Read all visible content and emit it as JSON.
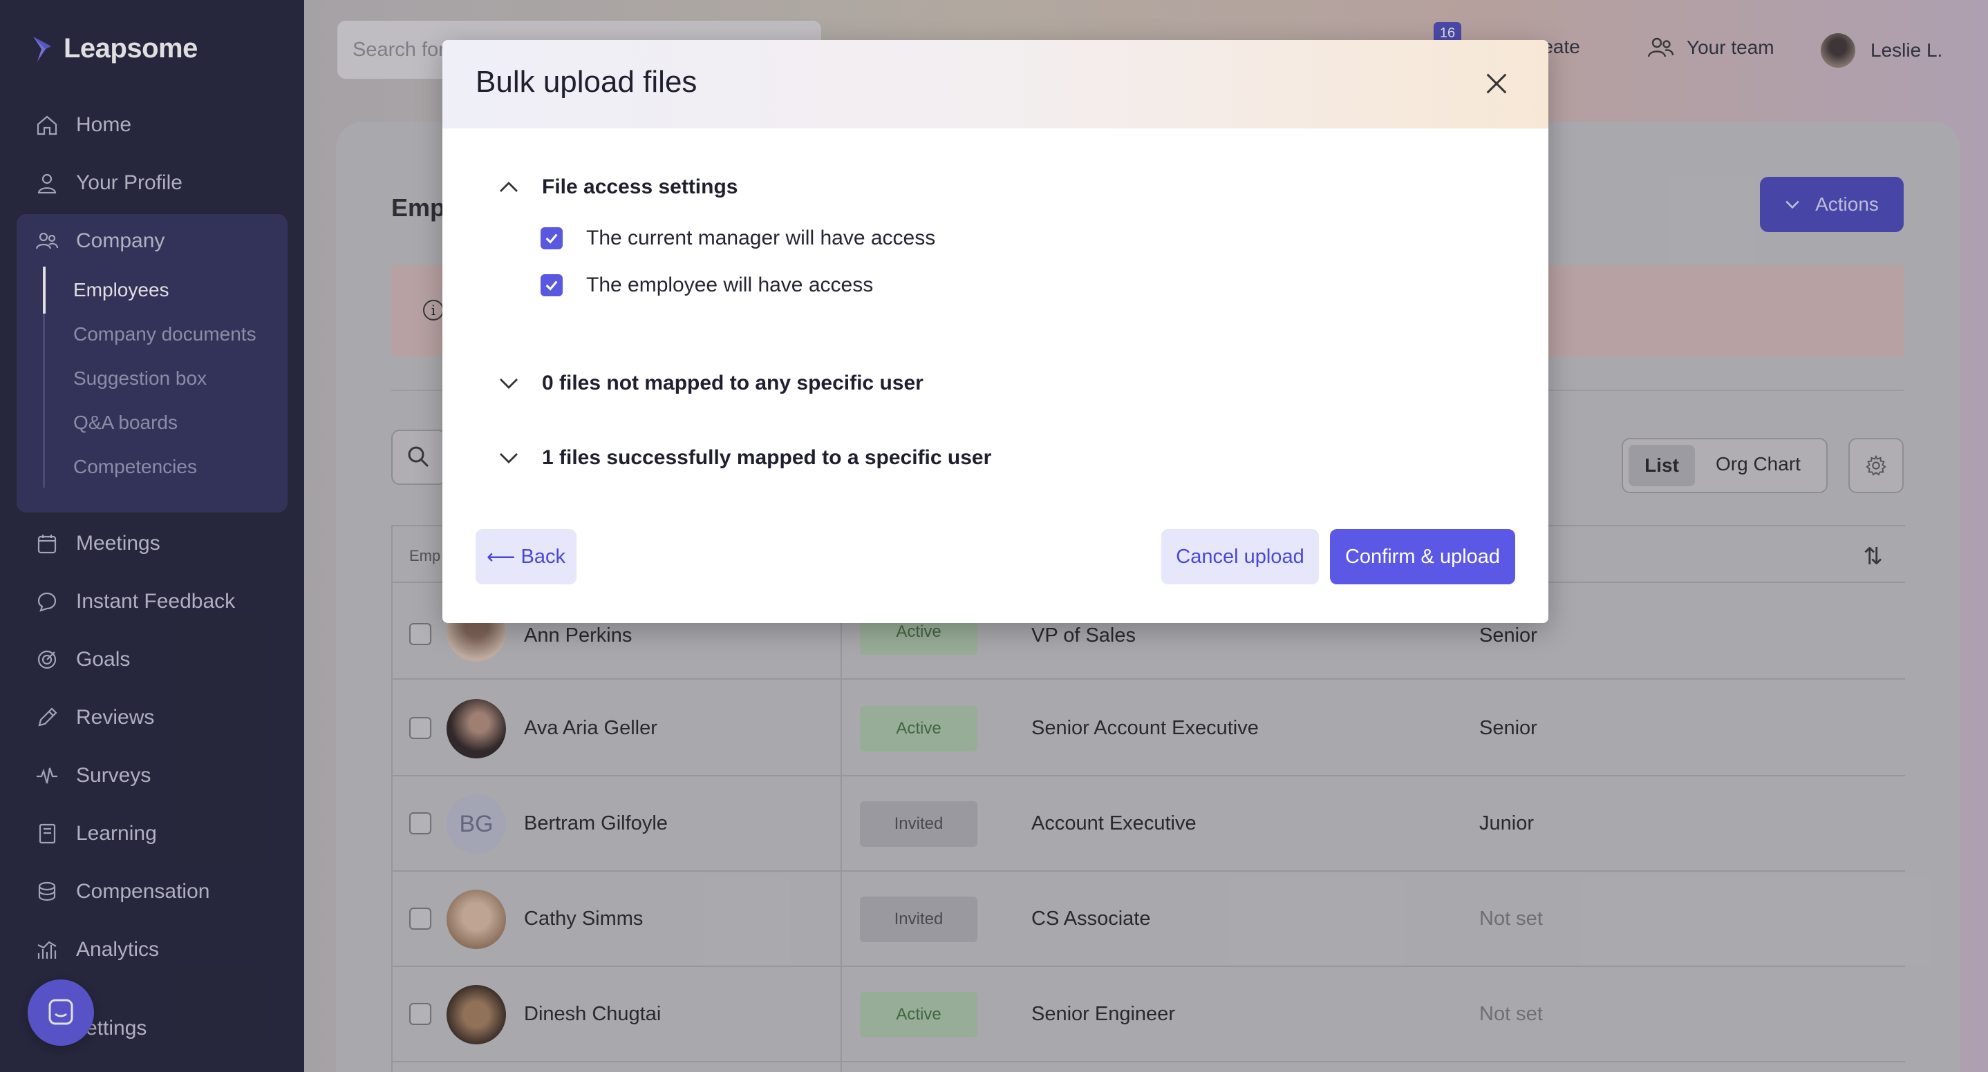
{
  "brand": {
    "name": "Leapsome"
  },
  "sidebar": {
    "items": [
      {
        "label": "Home",
        "icon": "home-icon"
      },
      {
        "label": "Your Profile",
        "icon": "user-icon"
      },
      {
        "label": "Company",
        "icon": "people-icon"
      },
      {
        "label": "Meetings",
        "icon": "calendar-icon"
      },
      {
        "label": "Instant Feedback",
        "icon": "chat-icon"
      },
      {
        "label": "Goals",
        "icon": "target-icon"
      },
      {
        "label": "Reviews",
        "icon": "pencil-icon"
      },
      {
        "label": "Surveys",
        "icon": "pulse-icon"
      },
      {
        "label": "Learning",
        "icon": "book-icon"
      },
      {
        "label": "Compensation",
        "icon": "coins-icon"
      },
      {
        "label": "Analytics",
        "icon": "chart-icon"
      },
      {
        "label": "ettings",
        "icon": "settings-icon"
      }
    ],
    "company_sub": [
      "Employees",
      "Company documents",
      "Suggestion box",
      "Q&A boards",
      "Competencies"
    ]
  },
  "topbar": {
    "search_placeholder": "Search for",
    "notification_count": "16",
    "create_label": "reate",
    "team_label": "Your team",
    "user_label": "Leslie L."
  },
  "page": {
    "title": "Emp",
    "actions_label": "Actions",
    "view_list": "List",
    "view_org": "Org Chart",
    "table_header_emp": "Emp"
  },
  "employees": [
    {
      "name": "Ann Perkins",
      "status": "Active",
      "role": "VP of Sales",
      "level": "Senior"
    },
    {
      "name": "Ava Aria Geller",
      "status": "Active",
      "role": "Senior Account Executive",
      "level": "Senior"
    },
    {
      "name": "Bertram Gilfoyle",
      "initials": "BG",
      "status": "Invited",
      "role": "Account Executive",
      "level": "Junior"
    },
    {
      "name": "Cathy Simms",
      "status": "Invited",
      "role": "CS Associate",
      "level": "Not set"
    },
    {
      "name": "Dinesh Chugtai",
      "status": "Active",
      "role": "Senior Engineer",
      "level": "Not set"
    }
  ],
  "modal": {
    "title": "Bulk upload files",
    "access_section": "File access settings",
    "check_manager": "The current manager will have access",
    "check_employee": "The employee will have access",
    "unmapped_section": "0 files not mapped to any specific user",
    "mapped_section": "1 files successfully mapped to a specific user",
    "back_label": "Back",
    "back_arrow": "⟵",
    "cancel_label": "Cancel upload",
    "confirm_label": "Confirm & upload"
  },
  "colors": {
    "accent": "#5c58e6",
    "sidebar": "#1e1e36",
    "active_badge": "#a9c2a6"
  }
}
